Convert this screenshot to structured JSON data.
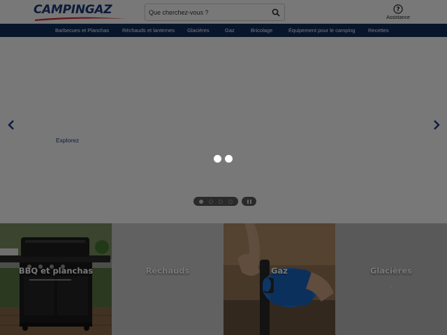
{
  "header": {
    "logo_text": "CAMPINGAZ",
    "search": {
      "placeholder": "Que cherchez-vous ?"
    },
    "assistance_label": "Assistance"
  },
  "nav": {
    "items": [
      {
        "label": "Barbecues et Planchas"
      },
      {
        "label": "Réchauds et lanternes"
      },
      {
        "label": "Glacières"
      },
      {
        "label": "Gaz"
      },
      {
        "label": "Bricolage"
      },
      {
        "label": "Équipement pour le camping"
      },
      {
        "label": "Recettes"
      }
    ]
  },
  "hero": {
    "explore_label": "Explorez",
    "slides_count": 4,
    "active_slide": 1
  },
  "categories": [
    {
      "label": "BBQ et planchas"
    },
    {
      "label": "Réchauds"
    },
    {
      "label": "Gaz"
    },
    {
      "label": "Glacières"
    }
  ],
  "colors": {
    "brand_blue": "#1c3b80",
    "nav_background": "#13305f",
    "logo_swoosh": "#d8202a",
    "overlay": "rgba(0,0,0,0.53)"
  },
  "icons": {
    "search": "search-icon",
    "assistance": "question-circle-icon",
    "prev": "chevron-left-icon",
    "next": "chevron-right-icon",
    "pause": "pause-icon"
  }
}
